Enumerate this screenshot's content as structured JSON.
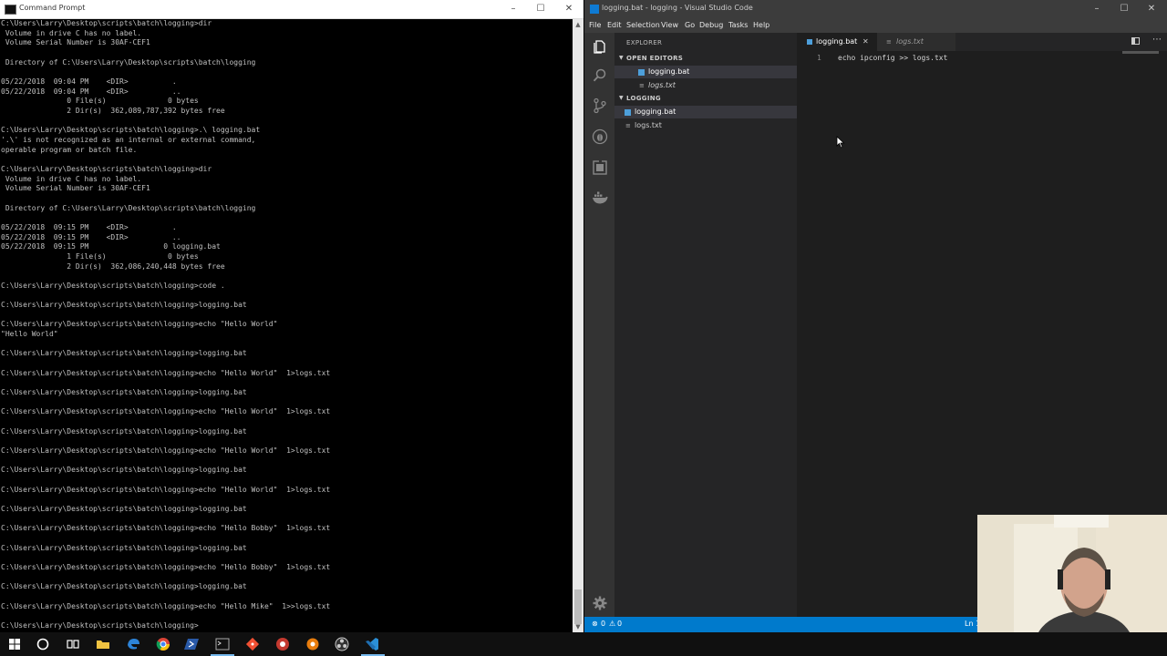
{
  "cmd": {
    "title": "Command Prompt",
    "lines": [
      "C:\\Users\\Larry\\Desktop\\scripts\\batch\\logging>dir",
      " Volume in drive C has no label.",
      " Volume Serial Number is 30AF-CEF1",
      "",
      " Directory of C:\\Users\\Larry\\Desktop\\scripts\\batch\\logging",
      "",
      "05/22/2018  09:04 PM    <DIR>          .",
      "05/22/2018  09:04 PM    <DIR>          ..",
      "               0 File(s)              0 bytes",
      "               2 Dir(s)  362,089,787,392 bytes free",
      "",
      "C:\\Users\\Larry\\Desktop\\scripts\\batch\\logging>.\\ logging.bat",
      "'.\\' is not recognized as an internal or external command,",
      "operable program or batch file.",
      "",
      "C:\\Users\\Larry\\Desktop\\scripts\\batch\\logging>dir",
      " Volume in drive C has no label.",
      " Volume Serial Number is 30AF-CEF1",
      "",
      " Directory of C:\\Users\\Larry\\Desktop\\scripts\\batch\\logging",
      "",
      "05/22/2018  09:15 PM    <DIR>          .",
      "05/22/2018  09:15 PM    <DIR>          ..",
      "05/22/2018  09:15 PM                 0 logging.bat",
      "               1 File(s)              0 bytes",
      "               2 Dir(s)  362,086,240,448 bytes free",
      "",
      "C:\\Users\\Larry\\Desktop\\scripts\\batch\\logging>code .",
      "",
      "C:\\Users\\Larry\\Desktop\\scripts\\batch\\logging>logging.bat",
      "",
      "C:\\Users\\Larry\\Desktop\\scripts\\batch\\logging>echo \"Hello World\"",
      "\"Hello World\"",
      "",
      "C:\\Users\\Larry\\Desktop\\scripts\\batch\\logging>logging.bat",
      "",
      "C:\\Users\\Larry\\Desktop\\scripts\\batch\\logging>echo \"Hello World\"  1>logs.txt",
      "",
      "C:\\Users\\Larry\\Desktop\\scripts\\batch\\logging>logging.bat",
      "",
      "C:\\Users\\Larry\\Desktop\\scripts\\batch\\logging>echo \"Hello World\"  1>logs.txt",
      "",
      "C:\\Users\\Larry\\Desktop\\scripts\\batch\\logging>logging.bat",
      "",
      "C:\\Users\\Larry\\Desktop\\scripts\\batch\\logging>echo \"Hello World\"  1>logs.txt",
      "",
      "C:\\Users\\Larry\\Desktop\\scripts\\batch\\logging>logging.bat",
      "",
      "C:\\Users\\Larry\\Desktop\\scripts\\batch\\logging>echo \"Hello World\"  1>logs.txt",
      "",
      "C:\\Users\\Larry\\Desktop\\scripts\\batch\\logging>logging.bat",
      "",
      "C:\\Users\\Larry\\Desktop\\scripts\\batch\\logging>echo \"Hello Bobby\"  1>logs.txt",
      "",
      "C:\\Users\\Larry\\Desktop\\scripts\\batch\\logging>logging.bat",
      "",
      "C:\\Users\\Larry\\Desktop\\scripts\\batch\\logging>echo \"Hello Bobby\"  1>logs.txt",
      "",
      "C:\\Users\\Larry\\Desktop\\scripts\\batch\\logging>logging.bat",
      "",
      "C:\\Users\\Larry\\Desktop\\scripts\\batch\\logging>echo \"Hello Mike\"  1>>logs.txt",
      "",
      "C:\\Users\\Larry\\Desktop\\scripts\\batch\\logging>"
    ]
  },
  "vscode": {
    "title": "logging.bat - logging - Visual Studio Code",
    "menu": [
      "File",
      "Edit",
      "Selection",
      "View",
      "Go",
      "Debug",
      "Tasks",
      "Help"
    ],
    "explorer_title": "EXPLORER",
    "open_editors_title": "OPEN EDITORS",
    "open_editors": [
      "logging.bat",
      "logs.txt"
    ],
    "folder_title": "LOGGING",
    "folder_files": [
      "logging.bat",
      "logs.txt"
    ],
    "tabs": [
      "logging.bat",
      "logs.txt"
    ],
    "code": {
      "line_number": "1",
      "text": "echo ipconfig >> logs.txt"
    },
    "status": {
      "errors": "0",
      "warnings": "0",
      "position": "Ln 1"
    }
  },
  "colors": {
    "vscode_blue": "#007acc",
    "cmd_text": "#c0c0c0"
  }
}
